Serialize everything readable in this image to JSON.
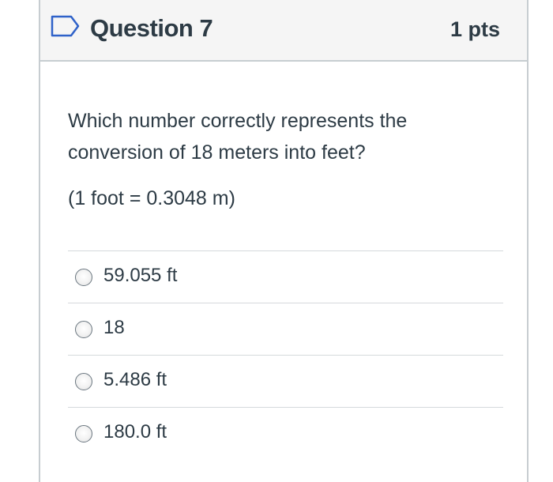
{
  "question": {
    "title": "Question 7",
    "points": "1 pts",
    "text_line1": "Which number correctly represents the",
    "text_line2": "conversion of 18 meters into feet?",
    "conversion_note": "(1 foot = 0.3048 m)"
  },
  "answers": [
    {
      "label": "59.055 ft",
      "selected": false
    },
    {
      "label": "18",
      "selected": false
    },
    {
      "label": "5.486 ft",
      "selected": false
    },
    {
      "label": "180.0 ft",
      "selected": false
    }
  ],
  "colors": {
    "text": "#2d3b45",
    "flag": "#2f62c9",
    "header_bg": "#f5f5f5",
    "border": "#c7cdd1"
  },
  "icons": {
    "flag": "flag-question-icon",
    "radio": "radio-button-icon"
  }
}
